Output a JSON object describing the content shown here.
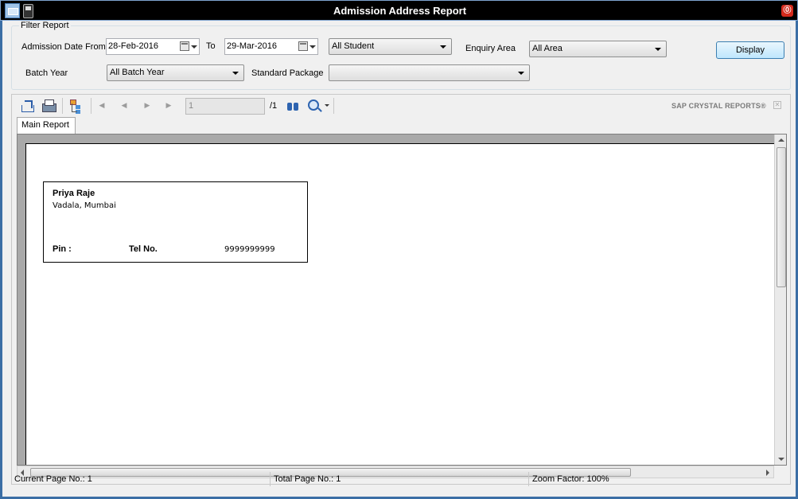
{
  "window": {
    "title": "Admission Address Report",
    "close_glyph": "⓪"
  },
  "filter": {
    "legend": "Filter Report",
    "admission_date_from_label": "Admission Date From",
    "date_from": "28-Feb-2016",
    "to_label": "To",
    "date_to": "29-Mar-2016",
    "student_select": "All Student",
    "enquiry_area_label": "Enquiry Area",
    "enquiry_area_select": "All Area",
    "batch_year_label": "Batch Year",
    "batch_year_select": "All Batch Year",
    "standard_package_label": "Standard Package",
    "standard_package_select": "",
    "display_button": "Display"
  },
  "viewer": {
    "page_number": "1",
    "page_total": "/1",
    "brand": "SAP CRYSTAL REPORTS®",
    "tab_label": "Main Report",
    "nav": {
      "first": "◀",
      "prev": "◀",
      "next": "▶",
      "last": "▶"
    },
    "close_glyph": "✕"
  },
  "report": {
    "name": "Priya Raje",
    "address": "Vadala, Mumbai",
    "pin_label": "Pin :",
    "tel_label": "Tel No.",
    "tel_value": "9999999999"
  },
  "status": {
    "current_page": "Current Page No.: 1",
    "total_page": "Total Page No.: 1",
    "zoom": "Zoom Factor: 100%"
  },
  "icons": [
    "mail-icon",
    "phone-icon",
    "export-icon",
    "print-icon",
    "group-tree-icon",
    "first-page-icon",
    "previous-page-icon",
    "next-page-icon",
    "last-page-icon",
    "find-icon",
    "zoom-icon",
    "calendar-icon",
    "close-icon"
  ]
}
